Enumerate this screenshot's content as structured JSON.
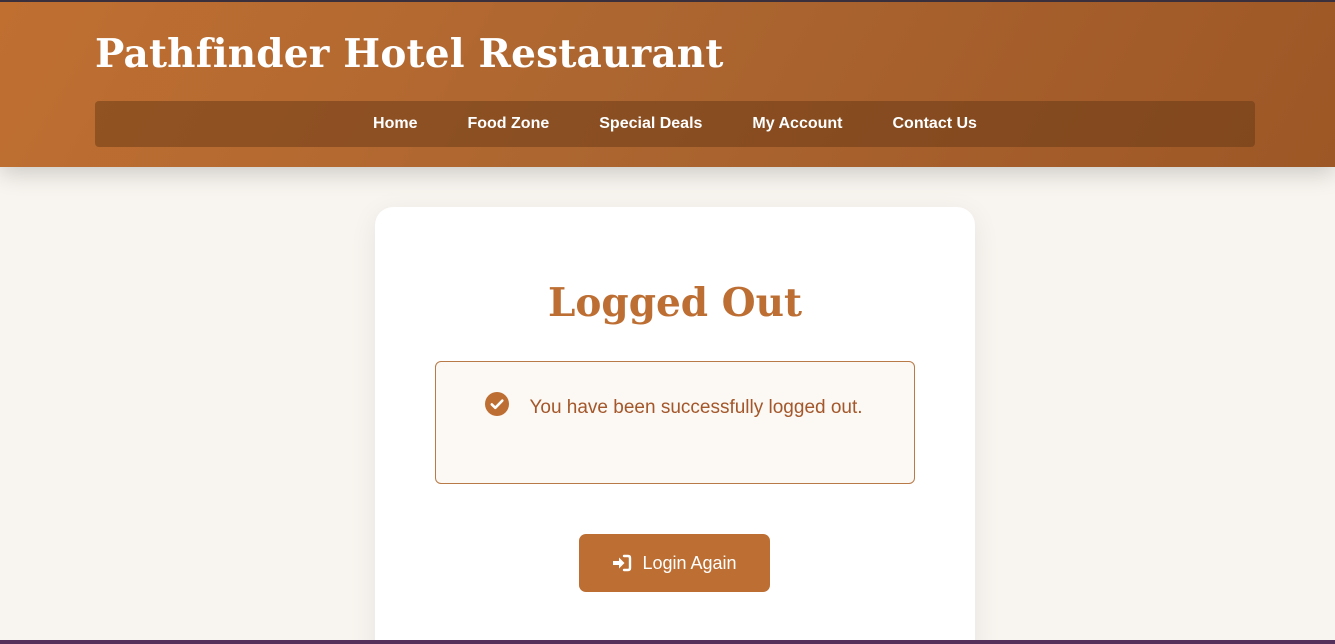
{
  "header": {
    "title": "Pathfinder Hotel Restaurant"
  },
  "nav": {
    "items": [
      {
        "label": "Home"
      },
      {
        "label": "Food Zone"
      },
      {
        "label": "Special Deals"
      },
      {
        "label": "My Account"
      },
      {
        "label": "Contact Us"
      }
    ]
  },
  "main": {
    "title": "Logged Out",
    "alert": {
      "icon": "check-circle-icon",
      "message": "You have been successfully logged out."
    },
    "login_button": {
      "icon": "sign-in-icon",
      "label": "Login Again"
    }
  },
  "colors": {
    "header_gradient_start": "#c06f31",
    "header_gradient_end": "#9d5726",
    "accent": "#bd6e33",
    "alert_text": "#a3572a",
    "page_background": "#f8f4ef"
  }
}
